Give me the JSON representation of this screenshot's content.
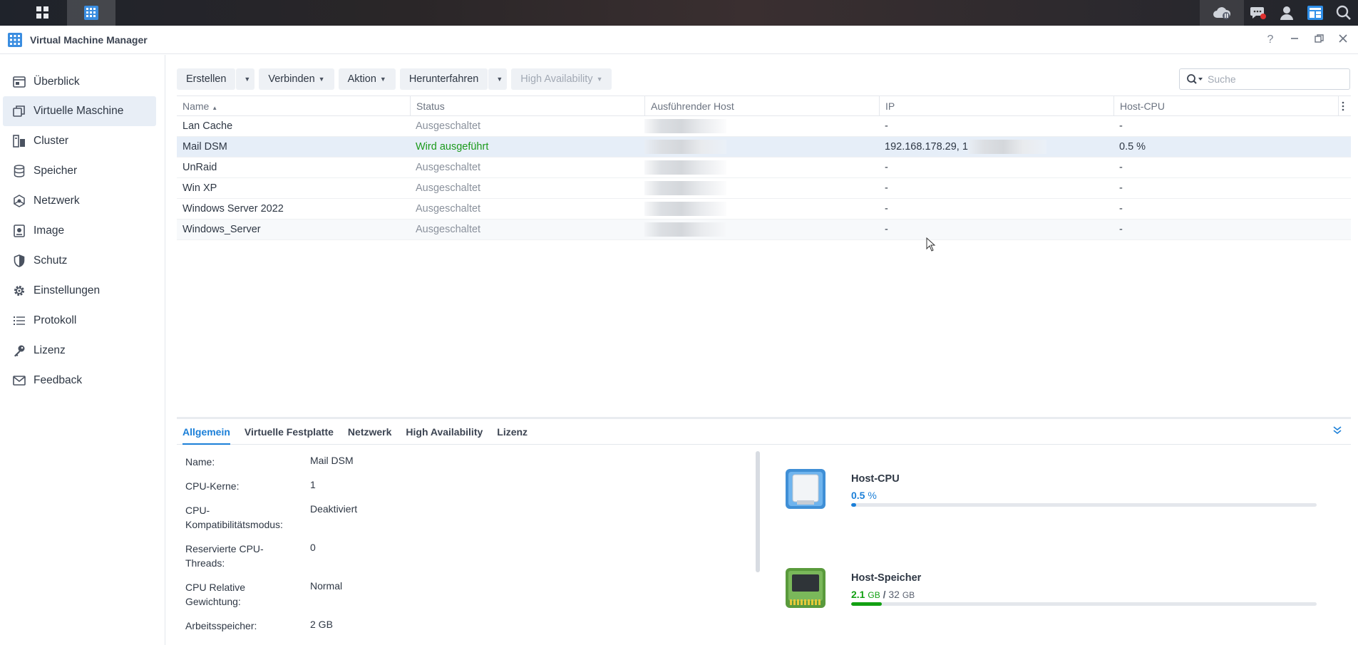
{
  "app": {
    "title": "Virtual Machine Manager"
  },
  "taskbar": {
    "left_icons": [
      "apps-grid-icon",
      "vmm-app-icon"
    ],
    "right_icons": [
      "cloud-sync-icon",
      "notifications-icon",
      "user-icon",
      "widgets-icon",
      "search-icon"
    ]
  },
  "window": {
    "controls": [
      "help-icon",
      "minimize-icon",
      "restore-icon",
      "close-icon"
    ],
    "help_label": "?"
  },
  "sidebar": {
    "items": [
      {
        "label": "Überblick",
        "icon": "overview-icon"
      },
      {
        "label": "Virtuelle Maschine",
        "icon": "virtual-machine-icon",
        "active": true
      },
      {
        "label": "Cluster",
        "icon": "cluster-icon"
      },
      {
        "label": "Speicher",
        "icon": "storage-icon"
      },
      {
        "label": "Netzwerk",
        "icon": "network-icon"
      },
      {
        "label": "Image",
        "icon": "image-icon"
      },
      {
        "label": "Schutz",
        "icon": "shield-icon"
      },
      {
        "label": "Einstellungen",
        "icon": "gear-icon"
      },
      {
        "label": "Protokoll",
        "icon": "log-list-icon"
      },
      {
        "label": "Lizenz",
        "icon": "key-icon"
      },
      {
        "label": "Feedback",
        "icon": "mail-icon"
      }
    ]
  },
  "toolbar": {
    "create": "Erstellen",
    "connect": "Verbinden",
    "action": "Aktion",
    "shutdown": "Herunterfahren",
    "high_availability": "High Availability"
  },
  "search": {
    "placeholder": "Suche"
  },
  "grid": {
    "columns": [
      "Name",
      "Status",
      "Ausführender Host",
      "IP",
      "Host-CPU"
    ],
    "sort_indicator": "▲",
    "rows": [
      {
        "name": "Lan Cache",
        "status": "Ausgeschaltet",
        "ip": "-",
        "cpu": "-"
      },
      {
        "name": "Mail DSM",
        "status": "Wird ausgeführt",
        "ip": "192.168.178.29, 1",
        "cpu": "0.5 %",
        "selected": true,
        "running": true
      },
      {
        "name": "UnRaid",
        "status": "Ausgeschaltet",
        "ip": "-",
        "cpu": "-"
      },
      {
        "name": "Win XP",
        "status": "Ausgeschaltet",
        "ip": "-",
        "cpu": "-"
      },
      {
        "name": "Windows Server 2022",
        "status": "Ausgeschaltet",
        "ip": "-",
        "cpu": "-"
      },
      {
        "name": "Windows_Server",
        "status": "Ausgeschaltet",
        "ip": "-",
        "cpu": "-"
      }
    ]
  },
  "detail": {
    "tabs": [
      "Allgemein",
      "Virtuelle Festplatte",
      "Netzwerk",
      "High Availability",
      "Lizenz"
    ],
    "active_tab": "Allgemein",
    "properties": [
      {
        "key": "Name:",
        "value": "Mail DSM"
      },
      {
        "key": "CPU-Kerne:",
        "value": "1"
      },
      {
        "key": "CPU-Kompatibilitätsmodus:",
        "value": "Deaktiviert"
      },
      {
        "key": "Reservierte CPU-Threads:",
        "value": "0"
      },
      {
        "key": "CPU Relative Gewichtung:",
        "value": "Normal"
      },
      {
        "key": "Arbeitsspeicher:",
        "value": "2 GB"
      }
    ],
    "host_cpu": {
      "title": "Host-CPU",
      "value": "0.5",
      "unit": "%",
      "percent": 0.5,
      "color": "#1b7fd8"
    },
    "host_memory": {
      "title": "Host-Speicher",
      "used": "2.1",
      "used_unit": "GB",
      "separator": "/",
      "total": "32",
      "total_unit": "GB",
      "fraction": 0.065625,
      "color": "#12a012"
    }
  }
}
